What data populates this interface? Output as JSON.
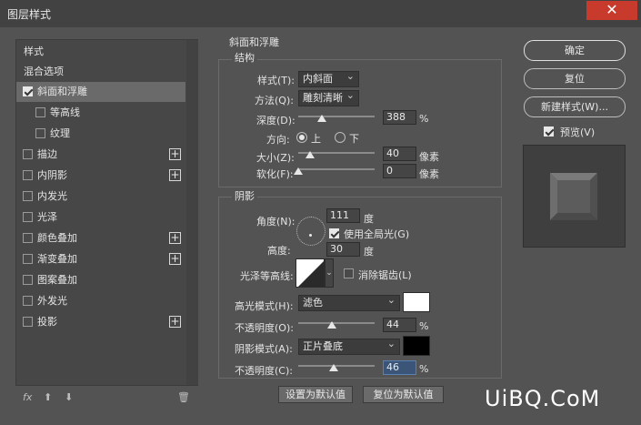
{
  "window": {
    "title": "图层样式",
    "close_glyph": "✕"
  },
  "left_panel": {
    "styles_header": "样式",
    "blending_options": "混合选项",
    "items": [
      {
        "label": "斜面和浮雕",
        "checked": true,
        "selected": true,
        "plus": false
      },
      {
        "label": "等高线",
        "checked": false,
        "plus": false
      },
      {
        "label": "纹理",
        "checked": false,
        "plus": false
      },
      {
        "label": "描边",
        "checked": false,
        "plus": true
      },
      {
        "label": "内阴影",
        "checked": false,
        "plus": true
      },
      {
        "label": "内发光",
        "checked": false,
        "plus": false
      },
      {
        "label": "光泽",
        "checked": false,
        "plus": false
      },
      {
        "label": "颜色叠加",
        "checked": false,
        "plus": true
      },
      {
        "label": "渐变叠加",
        "checked": false,
        "plus": true
      },
      {
        "label": "图案叠加",
        "checked": false,
        "plus": false
      },
      {
        "label": "外发光",
        "checked": false,
        "plus": false
      },
      {
        "label": "投影",
        "checked": false,
        "plus": true
      }
    ],
    "plus_glyph": "+",
    "bottom": {
      "fx": "fx",
      "up_glyph": "⬆",
      "down_glyph": "⬇",
      "trash_glyph": "🗑"
    }
  },
  "bevel": {
    "section_title": "斜面和浮雕",
    "structure_title": "结构",
    "style_label": "样式(T):",
    "style_value": "内斜面",
    "technique_label": "方法(Q):",
    "technique_value": "雕刻清晰",
    "depth_label": "深度(D):",
    "depth_value": "388",
    "depth_unit": "%",
    "depth_level": 0.31,
    "direction_label": "方向:",
    "direction_up": "上",
    "direction_down": "下",
    "size_label": "大小(Z):",
    "size_value": "40",
    "size_unit": "像素",
    "size_level": 0.16,
    "soften_label": "软化(F):",
    "soften_value": "0",
    "soften_unit": "像素",
    "soften_level": 0.0
  },
  "shading": {
    "title": "阴影",
    "angle_label": "角度(N):",
    "angle_value": "111",
    "angle_unit": "度",
    "global_light_label": "使用全局光(G)",
    "altitude_label": "高度:",
    "altitude_value": "30",
    "altitude_unit": "度",
    "gloss_label": "光泽等高线:",
    "antialias_label": "消除锯齿(L)",
    "highlight_mode_label": "高光模式(H):",
    "highlight_mode_value": "滤色",
    "highlight_color": "#ffffff",
    "highlight_opacity_label": "不透明度(O):",
    "highlight_opacity_value": "44",
    "highlight_opacity_unit": "%",
    "highlight_opacity_level": 0.44,
    "shadow_mode_label": "阴影模式(A):",
    "shadow_mode_value": "正片叠底",
    "shadow_color": "#000000",
    "shadow_opacity_label": "不透明度(C):",
    "shadow_opacity_value": "46",
    "shadow_opacity_unit": "%",
    "shadow_opacity_level": 0.46
  },
  "bottom_buttons": {
    "set_default": "设置为默认值",
    "reset_default": "复位为默认值"
  },
  "right_panel": {
    "ok": "确定",
    "reset": "复位",
    "new_style": "新建样式(W)...",
    "preview_label": "预览(V)",
    "preview_checked": true
  },
  "watermark": "UiBQ.CoM"
}
